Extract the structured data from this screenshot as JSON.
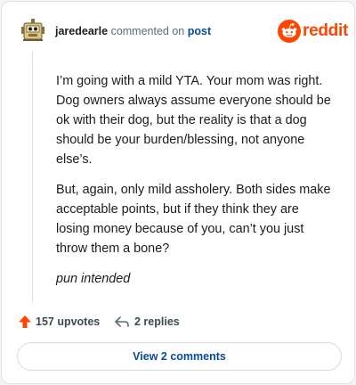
{
  "header": {
    "username": "jaredearle",
    "commented_text": "commented on",
    "post_link": "post",
    "brand": "reddit"
  },
  "comment": {
    "paragraphs": [
      "I’m going with a mild YTA. Your mom was right. Dog owners always assume everyone should be ok with their dog, but the reality is that a dog should be your burden/blessing, not anyone else’s.",
      "But, again, only mild assholery. Both sides make acceptable points, but if they think they are losing money because of you, can’t you just throw them a bone?",
      "pun intended"
    ]
  },
  "actions": {
    "upvotes": "157 upvotes",
    "replies": "2 replies"
  },
  "view_button": "View 2 comments",
  "colors": {
    "reddit_orange": "#ff4500",
    "link_blue": "#0a4a9c"
  }
}
